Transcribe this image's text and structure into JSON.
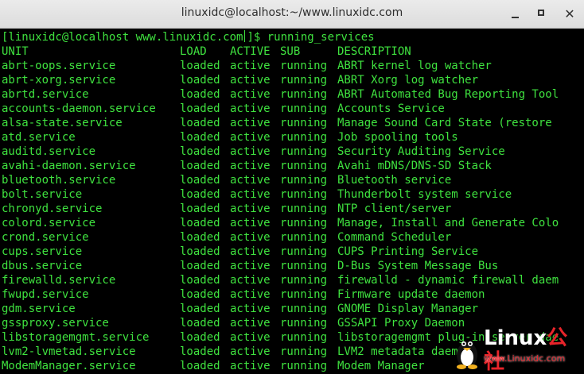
{
  "window": {
    "title": "linuxidc@localhost:~/www.linuxidc.com",
    "minimize_label": "",
    "maximize_label": "",
    "close_label": "✕"
  },
  "terminal": {
    "prompt": "[linuxidc@localhost www.linuxidc.com",
    "prompt_end": "]$ running_services",
    "text_color": "#3fe23f",
    "background": "#000000",
    "headers": {
      "unit": "UNIT",
      "load": "LOAD",
      "active": "ACTIVE",
      "sub": "SUB",
      "description": "DESCRIPTION"
    },
    "rows": [
      {
        "unit": "abrt-oops.service",
        "load": "loaded",
        "active": "active",
        "sub": "running",
        "description": "ABRT kernel log watcher"
      },
      {
        "unit": "abrt-xorg.service",
        "load": "loaded",
        "active": "active",
        "sub": "running",
        "description": "ABRT Xorg log watcher"
      },
      {
        "unit": "abrtd.service",
        "load": "loaded",
        "active": "active",
        "sub": "running",
        "description": "ABRT Automated Bug Reporting Tool"
      },
      {
        "unit": "accounts-daemon.service",
        "load": "loaded",
        "active": "active",
        "sub": "running",
        "description": "Accounts Service"
      },
      {
        "unit": "alsa-state.service",
        "load": "loaded",
        "active": "active",
        "sub": "running",
        "description": "Manage Sound Card State (restore"
      },
      {
        "unit": "atd.service",
        "load": "loaded",
        "active": "active",
        "sub": "running",
        "description": "Job spooling tools"
      },
      {
        "unit": "auditd.service",
        "load": "loaded",
        "active": "active",
        "sub": "running",
        "description": "Security Auditing Service"
      },
      {
        "unit": "avahi-daemon.service",
        "load": "loaded",
        "active": "active",
        "sub": "running",
        "description": "Avahi mDNS/DNS-SD Stack"
      },
      {
        "unit": "bluetooth.service",
        "load": "loaded",
        "active": "active",
        "sub": "running",
        "description": "Bluetooth service"
      },
      {
        "unit": "bolt.service",
        "load": "loaded",
        "active": "active",
        "sub": "running",
        "description": "Thunderbolt system service"
      },
      {
        "unit": "chronyd.service",
        "load": "loaded",
        "active": "active",
        "sub": "running",
        "description": "NTP client/server"
      },
      {
        "unit": "colord.service",
        "load": "loaded",
        "active": "active",
        "sub": "running",
        "description": "Manage, Install and Generate Colo"
      },
      {
        "unit": "crond.service",
        "load": "loaded",
        "active": "active",
        "sub": "running",
        "description": "Command Scheduler"
      },
      {
        "unit": "cups.service",
        "load": "loaded",
        "active": "active",
        "sub": "running",
        "description": "CUPS Printing Service"
      },
      {
        "unit": "dbus.service",
        "load": "loaded",
        "active": "active",
        "sub": "running",
        "description": "D-Bus System Message Bus"
      },
      {
        "unit": "firewalld.service",
        "load": "loaded",
        "active": "active",
        "sub": "running",
        "description": "firewalld - dynamic firewall daem"
      },
      {
        "unit": "fwupd.service",
        "load": "loaded",
        "active": "active",
        "sub": "running",
        "description": "Firmware update daemon"
      },
      {
        "unit": "gdm.service",
        "load": "loaded",
        "active": "active",
        "sub": "running",
        "description": "GNOME Display Manager"
      },
      {
        "unit": "gssproxy.service",
        "load": "loaded",
        "active": "active",
        "sub": "running",
        "description": "GSSAPI Proxy Daemon"
      },
      {
        "unit": "libstoragemgmt.service",
        "load": "loaded",
        "active": "active",
        "sub": "running",
        "description": "libstoragemgmt plug-in server dae"
      },
      {
        "unit": "lvm2-lvmetad.service",
        "load": "loaded",
        "active": "active",
        "sub": "running",
        "description": "LVM2 metadata daemon"
      },
      {
        "unit": "ModemManager.service",
        "load": "loaded",
        "active": "active",
        "sub": "running",
        "description": "Modem Manager"
      }
    ]
  },
  "watermark": {
    "brand_main": "Linux",
    "brand_accent": "公社",
    "url": "www.Linuxidc.com",
    "icon": "tux-penguin-icon"
  }
}
